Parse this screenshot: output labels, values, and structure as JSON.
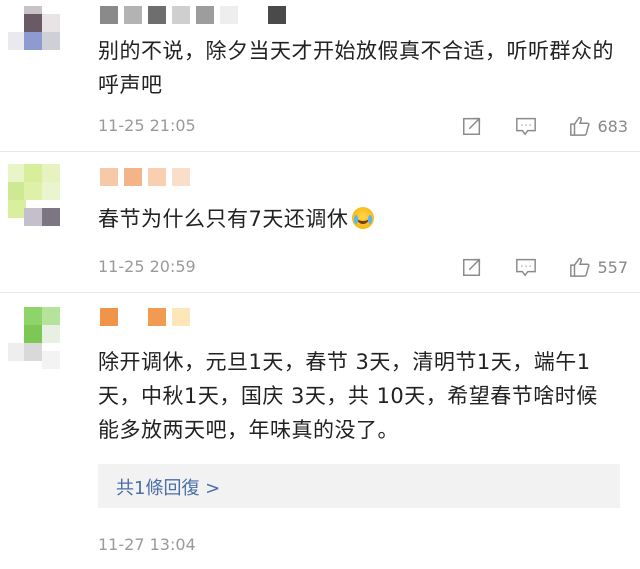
{
  "comments": [
    {
      "text": "别的不说，除夕当天才开始放假真不合适，听听群众的呼声吧",
      "time": "11-25 21:05",
      "likes": "683"
    },
    {
      "text": "春节为什么只有7天还调休",
      "emoji": "crying-laughing-emoji",
      "time": "11-25 20:59",
      "likes": "557"
    },
    {
      "text": "除开调休，元旦1天，春节 3天，清明节1天，端午1天，中秋1天，国庆 3天，共 10天，希望春节啥时候能多放两天吧，年味真的没了。",
      "reply_link": "共1條回復 >",
      "time": "11-27 13:04"
    }
  ],
  "icons": {
    "share": "share-icon",
    "comment": "comment-icon",
    "like": "thumbs-up-icon"
  },
  "colors": {
    "link": "#4a6ea8",
    "meta": "#9a9a9a",
    "divider": "#e6e6e6"
  }
}
